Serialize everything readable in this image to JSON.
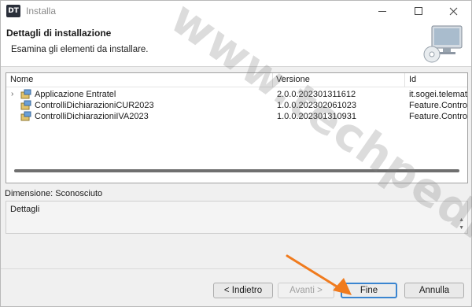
{
  "window": {
    "title": "Installa",
    "app_icon_text": "DT"
  },
  "banner": {
    "title": "Dettagli di installazione",
    "subtitle": "Esamina gli elementi da installare."
  },
  "table": {
    "headers": {
      "name": "Nome",
      "version": "Versione",
      "id": "Id"
    },
    "rows": [
      {
        "name": "Applicazione Entratel",
        "version": "2.0.0.202301311612",
        "id": "it.sogei.telematic",
        "expandable": true
      },
      {
        "name": "ControlliDichiarazioniCUR2023",
        "version": "1.0.0.202302061023",
        "id": "Feature.Controllil",
        "expandable": false
      },
      {
        "name": "ControlliDichiarazioniIVA2023",
        "version": "1.0.0.202301310931",
        "id": "Feature.Controllil",
        "expandable": false
      }
    ]
  },
  "dimension_text": "Dimensione: Sconosciuto",
  "details": {
    "label": "Dettagli"
  },
  "buttons": {
    "back": "< Indietro",
    "next": "Avanti >",
    "finish": "Fine",
    "cancel": "Annulla"
  },
  "watermark": "www.techpedia.it",
  "colors": {
    "focus_border": "#3a85d0",
    "arrow": "#f07b1e"
  }
}
